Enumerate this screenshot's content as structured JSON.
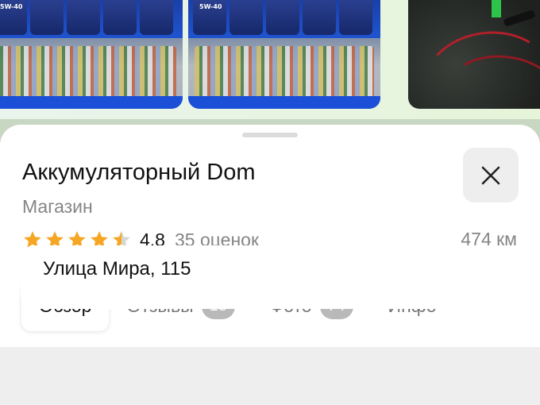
{
  "photos": {
    "items": [
      {
        "name": "shelf-photo-1",
        "oil_label": "5W-40"
      },
      {
        "name": "shelf-photo-2",
        "oil_label": "5W-40"
      },
      {
        "name": "cables-photo"
      }
    ]
  },
  "place": {
    "title": "Аккумуляторный Dom",
    "category": "Магазин",
    "rating": "4.8",
    "stars_value": 4.5,
    "reviews_count": "35 оценок",
    "distance": "474 км"
  },
  "tabs": [
    {
      "label": "Обзор",
      "badge": "",
      "active": true
    },
    {
      "label": "Отзывы",
      "badge": "18",
      "active": false
    },
    {
      "label": "Фото",
      "badge": "74",
      "active": false
    },
    {
      "label": "Инфо",
      "badge": "",
      "active": false
    }
  ],
  "address": {
    "text": "Улица Мира, 115"
  },
  "colors": {
    "star": "#f5a623",
    "star_empty": "#d6d6d6",
    "badge": "#b9b9b9"
  }
}
